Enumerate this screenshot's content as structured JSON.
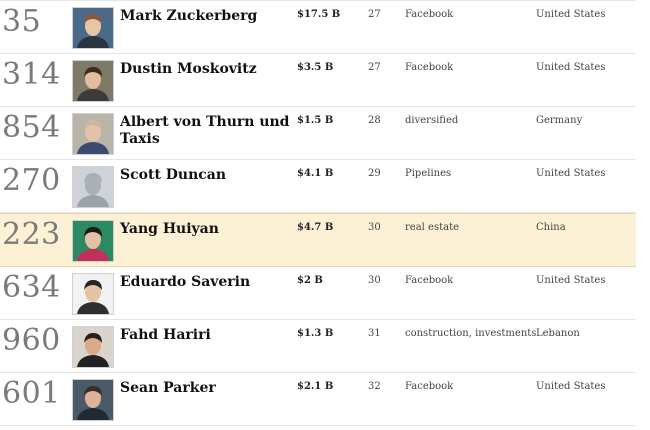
{
  "rows": [
    {
      "rank": "35",
      "name": "Mark Zuckerberg",
      "worth": "$17.5 B",
      "age": "27",
      "source": "Facebook",
      "country": "United States",
      "photo": {
        "bg": "#4b6a8a",
        "skin": "#e8c4a8",
        "hair": "#8a5b3a",
        "shirt": "#2c3440"
      }
    },
    {
      "rank": "314",
      "name": "Dustin Moskovitz",
      "worth": "$3.5 B",
      "age": "27",
      "source": "Facebook",
      "country": "United States",
      "photo": {
        "bg": "#7f7a66",
        "skin": "#e2bc9c",
        "hair": "#3a2a20",
        "shirt": "#3b3b3b"
      }
    },
    {
      "rank": "854",
      "name": "Albert von Thurn und Taxis",
      "worth": "$1.5 B",
      "age": "28",
      "source": "diversified",
      "country": "Germany",
      "photo": {
        "bg": "#b8b5a8",
        "skin": "#e3c3a9",
        "hair": "#c9b8a4",
        "shirt": "#3b4a6e"
      }
    },
    {
      "rank": "270",
      "name": "Scott Duncan",
      "worth": "$4.1 B",
      "age": "29",
      "source": "Pipelines",
      "country": "United States",
      "photo": {
        "bg": "#cfd3d8",
        "skin": "#a9b0b8",
        "hair": "#a9b0b8",
        "shirt": "#9aa2ab"
      }
    },
    {
      "rank": "223",
      "name": "Yang Huiyan",
      "worth": "$4.7 B",
      "age": "30",
      "source": "real estate",
      "country": "China",
      "photo": {
        "bg": "#2c8a62",
        "skin": "#e5c1a3",
        "hair": "#1e1a1a",
        "shirt": "#c2305a"
      }
    },
    {
      "rank": "634",
      "name": "Eduardo Saverin",
      "worth": "$2 B",
      "age": "30",
      "source": "Facebook",
      "country": "United States",
      "photo": {
        "bg": "#f2f2f2",
        "skin": "#e7c3a6",
        "hair": "#2a2420",
        "shirt": "#2f2f2f"
      }
    },
    {
      "rank": "960",
      "name": "Fahd Hariri",
      "worth": "$1.3 B",
      "age": "31",
      "source": "construction, investments",
      "country": "Lebanon",
      "photo": {
        "bg": "#d9d4cc",
        "skin": "#d9ab8a",
        "hair": "#2a1e18",
        "shirt": "#222222"
      }
    },
    {
      "rank": "601",
      "name": "Sean Parker",
      "worth": "$2.1 B",
      "age": "32",
      "source": "Facebook",
      "country": "United States",
      "photo": {
        "bg": "#4a5a66",
        "skin": "#dcb395",
        "hair": "#3a2e28",
        "shirt": "#1f2a33"
      }
    }
  ],
  "highlight_color": "#fdf1d5"
}
